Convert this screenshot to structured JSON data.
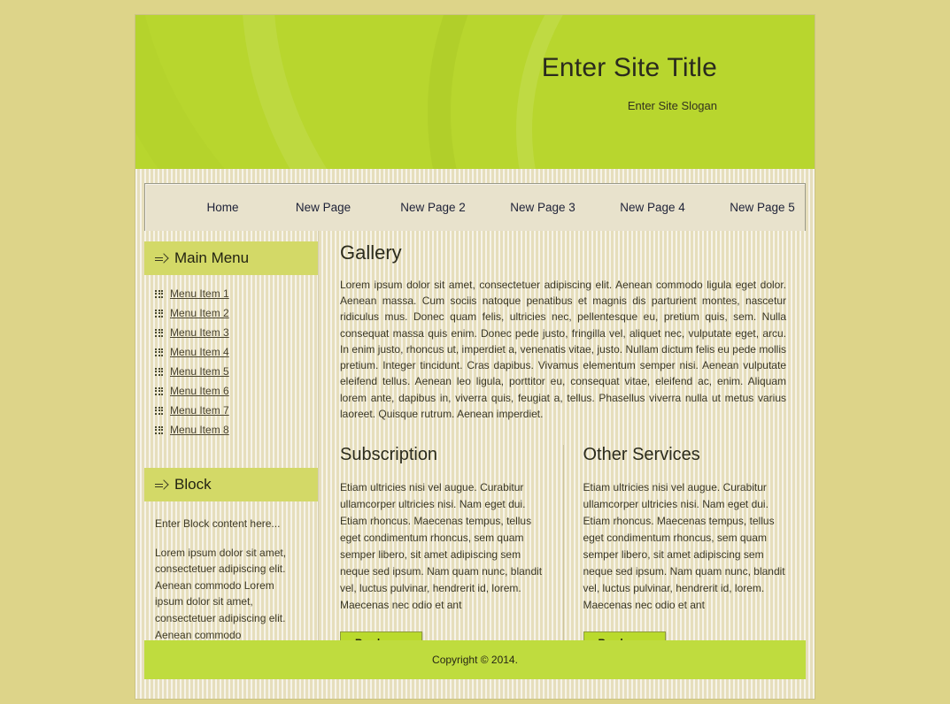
{
  "site": {
    "title": "Enter Site Title",
    "slogan": "Enter Site Slogan"
  },
  "colors": {
    "page_background": "#ddd489",
    "masthead_green": "#b8d62e",
    "block_header_green": "#d3d967",
    "footer_green": "#bfdc3e",
    "button_green": "#bada2d",
    "content_cream": "#ece5cc",
    "nav_text": "#1d2137"
  },
  "nav": {
    "items": [
      {
        "label": "Home"
      },
      {
        "label": "New Page"
      },
      {
        "label": "New Page 2"
      },
      {
        "label": "New Page 3"
      },
      {
        "label": "New Page 4"
      },
      {
        "label": "New Page 5"
      }
    ]
  },
  "sidebar": {
    "main_menu": {
      "heading": "Main Menu",
      "arrow_icon": "arrow-right-icon",
      "items": [
        {
          "label": "Menu Item 1",
          "icon": "grid-icon"
        },
        {
          "label": "Menu Item 2",
          "icon": "grid-icon"
        },
        {
          "label": "Menu Item 3",
          "icon": "grid-icon"
        },
        {
          "label": "Menu Item 4",
          "icon": "grid-icon"
        },
        {
          "label": "Menu Item 5",
          "icon": "grid-icon"
        },
        {
          "label": "Menu Item 6",
          "icon": "grid-icon"
        },
        {
          "label": "Menu Item 7",
          "icon": "grid-icon"
        },
        {
          "label": "Menu Item 8",
          "icon": "grid-icon"
        }
      ]
    },
    "block": {
      "heading": "Block",
      "arrow_icon": "arrow-right-icon",
      "intro": "Enter Block content here...",
      "body": "Lorem ipsum dolor sit amet, consectetuer adipiscing elit. Aenean commodo Lorem ipsum dolor sit amet, consectetuer adipiscing elit. Aenean commodo"
    }
  },
  "main": {
    "gallery": {
      "heading": "Gallery",
      "body": "Lorem ipsum dolor sit amet, consectetuer adipiscing elit. Aenean commodo ligula eget dolor. Aenean massa. Cum sociis natoque penatibus et magnis dis parturient montes, nascetur ridiculus mus. Donec quam felis, ultricies nec, pellentesque eu, pretium quis, sem. Nulla consequat massa quis enim. Donec pede justo, fringilla vel, aliquet nec, vulputate eget, arcu. In enim justo, rhoncus ut, imperdiet a, venenatis vitae, justo. Nullam dictum felis eu pede mollis pretium. Integer tincidunt. Cras dapibus. Vivamus elementum semper nisi. Aenean vulputate eleifend tellus. Aenean leo ligula, porttitor eu, consequat vitae, eleifend ac, enim. Aliquam lorem ante, dapibus in, viverra quis, feugiat a, tellus. Phasellus viverra nulla ut metus varius laoreet. Quisque rutrum. Aenean imperdiet."
    },
    "columns": [
      {
        "heading": "Subscription",
        "body": "Etiam ultricies nisi vel augue. Curabitur ullamcorper ultricies nisi. Nam eget dui. Etiam rhoncus. Maecenas tempus, tellus eget condimentum rhoncus, sem quam semper libero, sit amet adipiscing sem neque sed ipsum. Nam quam nunc, blandit vel, luctus pulvinar, hendrerit id, lorem. Maecenas nec odio et ant",
        "button": "Read more"
      },
      {
        "heading": "Other Services",
        "body": "Etiam ultricies nisi vel augue. Curabitur ullamcorper ultricies nisi. Nam eget dui. Etiam rhoncus. Maecenas tempus, tellus eget condimentum rhoncus, sem quam semper libero, sit amet adipiscing sem neque sed ipsum. Nam quam nunc, blandit vel, luctus pulvinar, hendrerit id, lorem. Maecenas nec odio et ant",
        "button": "Read more"
      }
    ]
  },
  "footer": {
    "copyright": "Copyright © 2014."
  }
}
